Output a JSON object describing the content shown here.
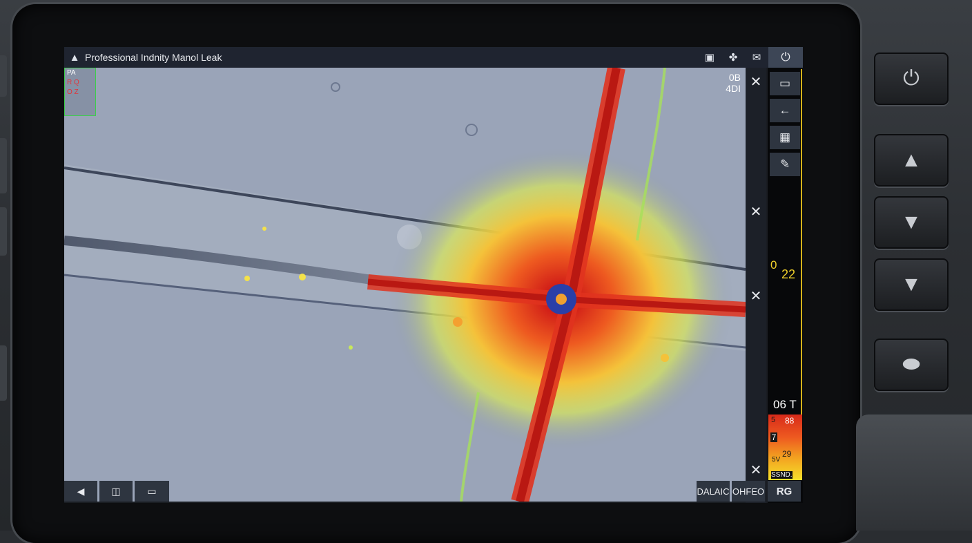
{
  "window": {
    "title": "Professional Indnity Manol Leak",
    "app_icon": "alert-icon",
    "toolbar_icons": [
      "save-icon",
      "fan-icon",
      "mail-icon"
    ],
    "power_icon": "power-icon"
  },
  "view": {
    "corner_box": {
      "label": "PA",
      "lines": [
        "R Q",
        "O  Z"
      ]
    },
    "top_right_readout": [
      "0B",
      "4DI"
    ],
    "pointer_icon": "pointer-icon"
  },
  "right_rail": {
    "icons": [
      "crosshair-icon",
      "crosshair-icon",
      "crosshair-icon",
      "crosshair-icon"
    ]
  },
  "side_panel": {
    "buttons": [
      "frame-icon",
      "back-arrow-icon",
      "image-icon",
      "edit-icon"
    ],
    "scale": {
      "low": "0",
      "high": "22",
      "max": "06 T"
    },
    "palette": {
      "a": "5",
      "b": "88",
      "c": "7",
      "d": "29",
      "e": "5V",
      "f": "SSND."
    }
  },
  "bottom_bar": {
    "left_buttons": [
      "play-left-icon",
      "split-icon",
      "minimize-icon"
    ],
    "right_buttons": [
      "DALAIC",
      "OHFEO",
      "RG"
    ]
  },
  "hardware": {
    "buttons": [
      "power-icon",
      "up-arrow-icon",
      "down-arrow-icon",
      "down-arrow-icon",
      "oval-icon"
    ]
  },
  "colors": {
    "hotspot_core": "#d22018",
    "hotspot_mid": "#f08a1e",
    "hotspot_outer": "#f4e24a",
    "scale_accent": "#d4b21a"
  }
}
